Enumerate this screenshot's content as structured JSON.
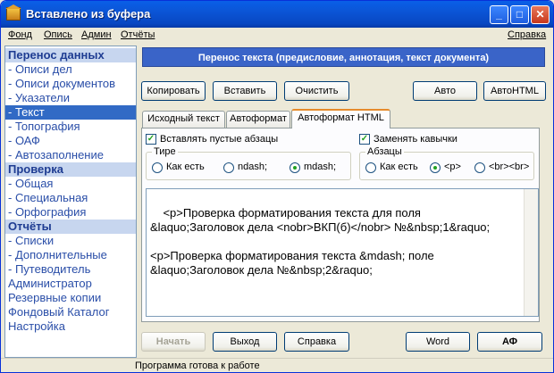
{
  "window": {
    "title": "Вставлено из буфера"
  },
  "menu": {
    "file": "Фонд",
    "list": "Опись",
    "admin": "Админ",
    "reports": "Отчёты",
    "help": "Справка"
  },
  "sidebar": {
    "h1": "Перенос данных",
    "items1": [
      "- Описи дел",
      "- Описи документов",
      "- Указатели",
      "- Текст",
      "- Топография",
      "- ОАФ",
      "- Автозаполнение"
    ],
    "h2": "Проверка",
    "items2": [
      "- Общая",
      "- Специальная",
      "- Орфография"
    ],
    "h3": "Отчёты",
    "items3": [
      "- Списки",
      "- Дополнительные",
      "- Путеводитель"
    ],
    "plain": [
      "Администратор",
      "Резервные копии",
      "Фондовый Каталог",
      "Настройка"
    ]
  },
  "banner": "Перенос текста (предисловие, аннотация, текст документа)",
  "toolbar": {
    "copy": "Копировать",
    "paste": "Вставить",
    "clear": "Очистить",
    "auto": "Авто",
    "autohtml": "АвтоHTML"
  },
  "tabs": [
    "Исходный текст",
    "Автоформат",
    "Автоформат HTML"
  ],
  "options": {
    "insert_empty": "Вставлять пустые абзацы",
    "replace_quotes": "Заменять кавычки",
    "dash_group": "Тире",
    "dash_asis": "Как есть",
    "dash_ndash": "ndash;",
    "dash_mdash": "mdash;",
    "para_group": "Абзацы",
    "para_asis": "Как есть",
    "para_p": "<p>",
    "para_br": "<br><br>"
  },
  "content": "<p>Проверка форматирования текста для поля\n&laquo;Заголовок дела <nobr>ВКП(б)</nobr> №&nbsp;1&raquo;\n\n<p>Проверка форматирования текста &mdash; поле\n&laquo;Заголовок дела №&nbsp;2&raquo;",
  "bottom": {
    "start": "Начать",
    "exit": "Выход",
    "help": "Справка",
    "word": "Word",
    "af": "АФ"
  },
  "status": "Программа готова к работе"
}
